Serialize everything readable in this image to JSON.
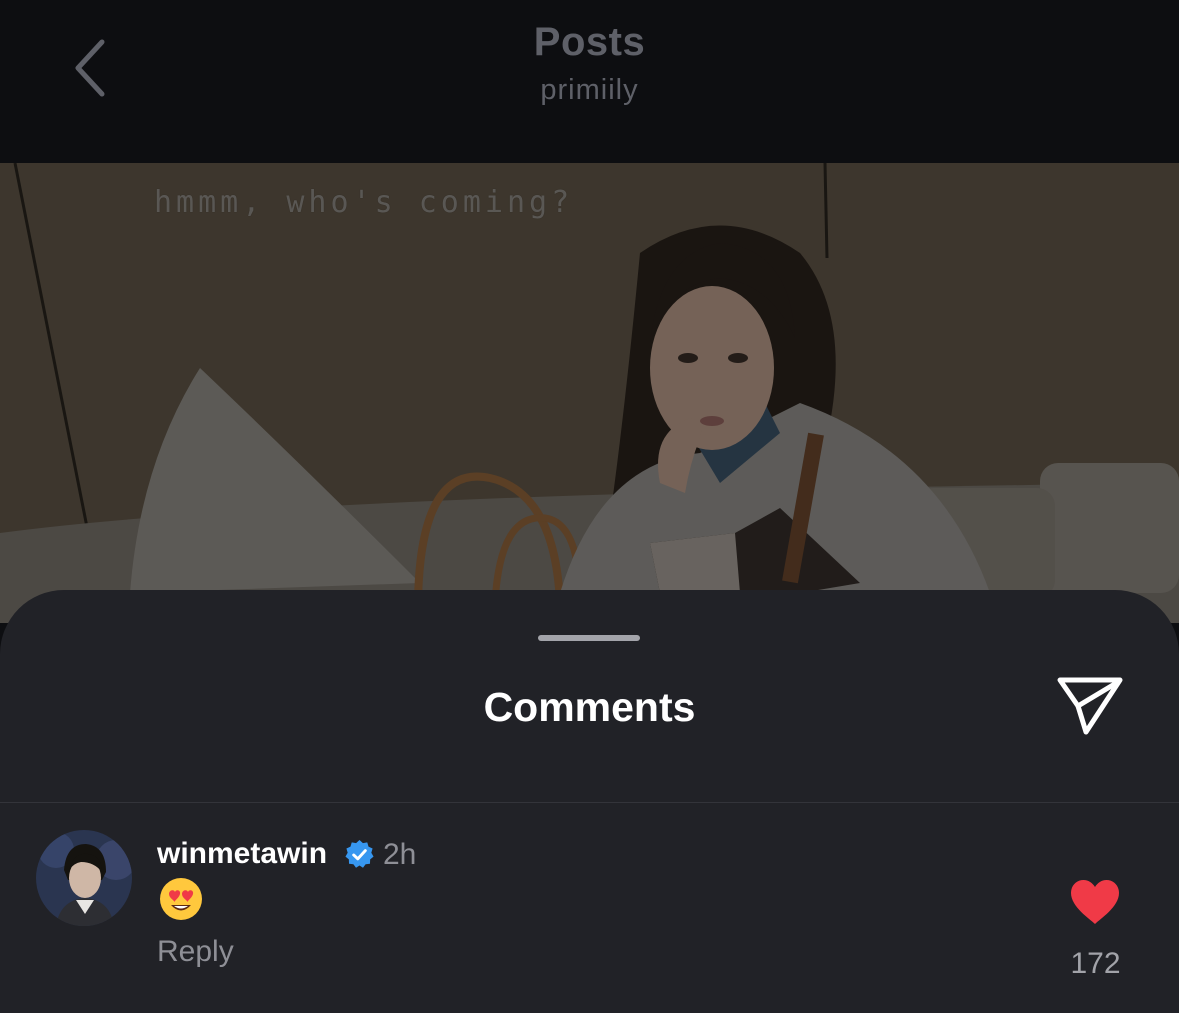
{
  "header": {
    "title": "Posts",
    "subtitle": "primiily"
  },
  "post": {
    "caption": "hmmm, who's coming?"
  },
  "comments_sheet": {
    "title": "Comments",
    "comments": [
      {
        "username": "winmetawin",
        "verified": true,
        "time": "2h",
        "text_emoji": "smiling-face-with-heart-eyes",
        "reply_label": "Reply",
        "like_count": "172",
        "liked": true
      }
    ]
  },
  "colors": {
    "sheet_background": "#212227",
    "header_background": "#0d0e11",
    "like_red": "#f03a47",
    "verified_blue": "#3797f0"
  }
}
